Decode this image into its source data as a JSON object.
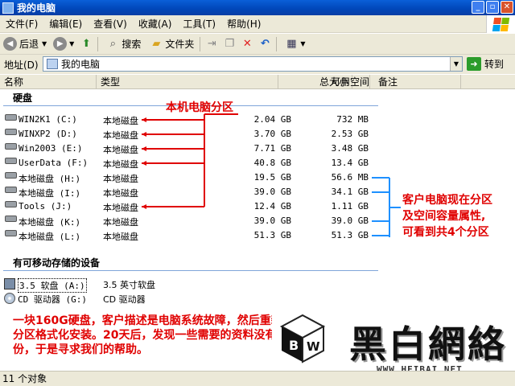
{
  "window": {
    "title": "我的电脑"
  },
  "menu": [
    "文件(F)",
    "编辑(E)",
    "查看(V)",
    "收藏(A)",
    "工具(T)",
    "帮助(H)"
  ],
  "toolbar": {
    "back": "后退",
    "search": "搜索",
    "folders": "文件夹"
  },
  "address": {
    "label": "地址(D)",
    "value": "我的电脑",
    "go": "转到"
  },
  "columns": [
    "名称",
    "类型",
    "总大小",
    "可用空间",
    "备注"
  ],
  "hard_disks": {
    "title": "硬盘",
    "rows": [
      {
        "name": "WIN2K1 (C:)",
        "type": "本地磁盘",
        "total": "2.04 GB",
        "free": "732 MB"
      },
      {
        "name": "WINXP2 (D:)",
        "type": "本地磁盘",
        "total": "3.70 GB",
        "free": "2.53 GB"
      },
      {
        "name": "Win2003 (E:)",
        "type": "本地磁盘",
        "total": "7.71 GB",
        "free": "3.48 GB"
      },
      {
        "name": "UserData (F:)",
        "type": "本地磁盘",
        "total": "40.8 GB",
        "free": "13.4 GB"
      },
      {
        "name": "本地磁盘 (H:)",
        "type": "本地磁盘",
        "total": "19.5 GB",
        "free": "56.6 MB"
      },
      {
        "name": "本地磁盘 (I:)",
        "type": "本地磁盘",
        "total": "39.0 GB",
        "free": "34.1 GB"
      },
      {
        "name": "Tools (J:)",
        "type": "本地磁盘",
        "total": "12.4 GB",
        "free": "1.11 GB"
      },
      {
        "name": "本地磁盘 (K:)",
        "type": "本地磁盘",
        "total": "39.0 GB",
        "free": "39.0 GB"
      },
      {
        "name": "本地磁盘 (L:)",
        "type": "本地磁盘",
        "total": "51.3 GB",
        "free": "51.3 GB"
      }
    ]
  },
  "removable": {
    "title": "有可移动存储的设备",
    "rows": [
      {
        "name": "3.5 软盘 (A:)",
        "type": "3.5 英寸软盘"
      },
      {
        "name": "CD 驱动器 (G:)",
        "type": "CD 驱动器"
      }
    ]
  },
  "annotations": {
    "partition_label": "本机电脑分区",
    "customer_note": [
      "客户电脑现在分区",
      "及空间容量属性,",
      "可看到共4个分区"
    ],
    "story": "一块160G硬盘，客户描述是电脑系统故障，然后重新分区格式化安装。20天后，发现一些需要的资料没有备份，于是寻求我们的帮助。"
  },
  "watermark": {
    "brand": "黑白網絡",
    "url": "WWW.HEIBAI.NET"
  },
  "status": {
    "text": "11 个对象"
  },
  "colors": {
    "accent_red": "#e00000",
    "accent_blue": "#1e90ff",
    "title_blue": "#0054e3"
  }
}
